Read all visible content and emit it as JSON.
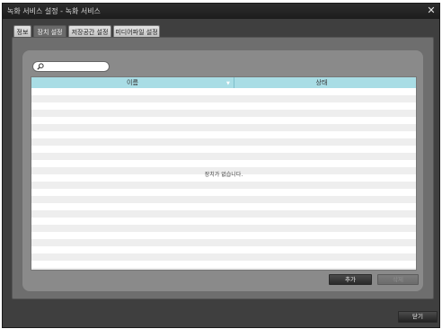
{
  "window": {
    "title": "녹화 서비스 설정 - 녹화 서비스",
    "close_glyph": "✕"
  },
  "tabs": [
    {
      "label": "정보",
      "active": false
    },
    {
      "label": "장치 설정",
      "active": true
    },
    {
      "label": "저장공간 설정",
      "active": false
    },
    {
      "label": "미디어파일 설정",
      "active": false
    }
  ],
  "search": {
    "placeholder": "",
    "value": ""
  },
  "table": {
    "columns": [
      {
        "label": "이름",
        "sort": "▼"
      },
      {
        "label": "상태"
      }
    ],
    "rows": [],
    "empty_message": "장치가 없습니다."
  },
  "buttons": {
    "add": "추가",
    "delete": "삭제",
    "close": "닫기"
  },
  "colors": {
    "header": "#a9dde5",
    "panel": "#6e6e6e",
    "inner": "#8a8a8a",
    "window": "#3f3f3f"
  }
}
